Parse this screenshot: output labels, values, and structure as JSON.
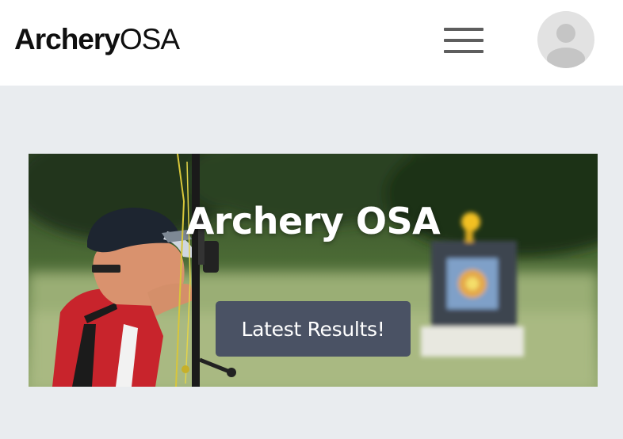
{
  "header": {
    "logo_bold": "Archery",
    "logo_light": "OSA",
    "menu_icon": "hamburger-menu-icon",
    "avatar_icon": "user-avatar-icon"
  },
  "hero": {
    "title": "Archery OSA",
    "button_label": "Latest Results!",
    "image_subject": "archer drawing a compound bow toward a target in a field",
    "button_color": "#4a5264"
  },
  "colors": {
    "page_background": "#e9ecef",
    "header_background": "#ffffff",
    "menu_icon": "#5e5e5e",
    "avatar_background": "#e2e2e2",
    "avatar_silhouette": "#c5c5c5"
  }
}
